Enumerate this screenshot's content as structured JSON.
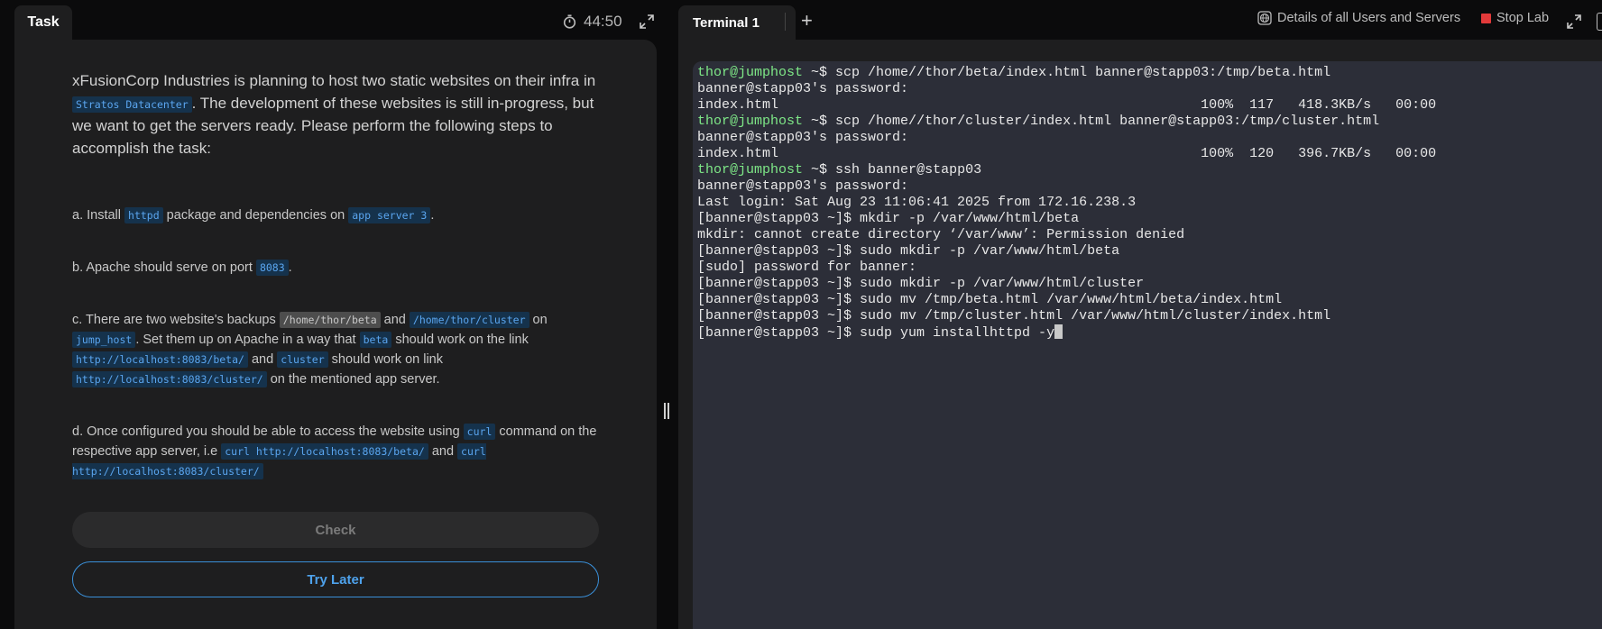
{
  "task": {
    "tab_label": "Task",
    "timer": "44:50",
    "intro_1": "xFusionCorp Industries is planning to host two static websites on their infra in ",
    "intro_code": "Stratos Datacenter",
    "intro_2": ". The development of these websites is still in-progress, but we want to get the servers ready. Please perform the following steps to accomplish the task:",
    "step_a": {
      "t1": "a. Install ",
      "c1": "httpd",
      "t2": " package and dependencies on ",
      "c2": "app server 3",
      "t3": "."
    },
    "step_b": {
      "t1": "b. Apache should serve on port ",
      "c1": "8083",
      "t2": "."
    },
    "step_c": {
      "t1": "c. There are two website's backups ",
      "c1": "/home/thor/beta",
      "t2": " and ",
      "c2": "/home/thor/cluster",
      "t3": " on ",
      "c3": "jump_host",
      "t4": ". Set them up on Apache in a way that ",
      "c4": "beta",
      "t5": " should work on the link ",
      "c5": "http://localhost:8083/beta/",
      "t6": " and ",
      "c6": "cluster",
      "t7": " should work on link ",
      "c7": "http://localhost:8083/cluster/",
      "t8": " on the mentioned app server."
    },
    "step_d": {
      "t1": "d. Once configured you should be able to access the website using ",
      "c1": "curl",
      "t2": " command on the respective app server, i.e ",
      "c2": "curl http://localhost:8083/beta/",
      "t3": " and ",
      "c3": "curl http://localhost:8083/cluster/"
    },
    "check_label": "Check",
    "try_later_label": "Try Later"
  },
  "terminal": {
    "tab_label": "Terminal 1",
    "details_label": "Details of all Users and Servers",
    "stop_label": "Stop Lab",
    "lines": [
      {
        "prompt": "thor@jumphost ",
        "dollar": "~$",
        "text": " scp /home//thor/beta/index.html banner@stapp03:/tmp/beta.html"
      },
      {
        "text": "banner@stapp03's password:"
      },
      {
        "text": "index.html                                                    100%  117   418.3KB/s   00:00"
      },
      {
        "prompt": "thor@jumphost ",
        "dollar": "~$",
        "text": " scp /home//thor/cluster/index.html banner@stapp03:/tmp/cluster.html"
      },
      {
        "text": "banner@stapp03's password:"
      },
      {
        "text": "index.html                                                    100%  120   396.7KB/s   00:00"
      },
      {
        "prompt": "thor@jumphost ",
        "dollar": "~$",
        "text": " ssh banner@stapp03"
      },
      {
        "text": "banner@stapp03's password:"
      },
      {
        "text": "Last login: Sat Aug 23 11:06:41 2025 from 172.16.238.3"
      },
      {
        "text": "[banner@stapp03 ~]$ mkdir -p /var/www/html/beta"
      },
      {
        "text": "mkdir: cannot create directory ‘/var/www’: Permission denied"
      },
      {
        "text": "[banner@stapp03 ~]$ sudo mkdir -p /var/www/html/beta"
      },
      {
        "text": "[sudo] password for banner:"
      },
      {
        "text": "[banner@stapp03 ~]$ sudo mkdir -p /var/www/html/cluster"
      },
      {
        "text": "[banner@stapp03 ~]$ sudo mv /tmp/beta.html /var/www/html/beta/index.html"
      },
      {
        "text": "[banner@stapp03 ~]$ sudo mv /tmp/cluster.html /var/www/html/cluster/index.html"
      },
      {
        "text": "[banner@stapp03 ~]$ sudp yum installhttpd -y",
        "cursor": true
      }
    ]
  }
}
